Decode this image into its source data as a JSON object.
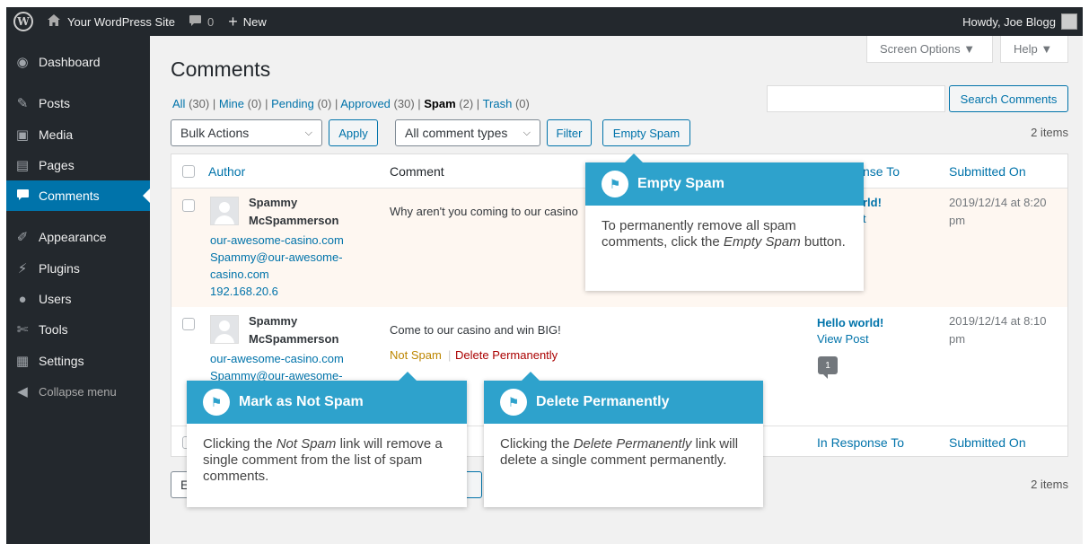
{
  "adminbar": {
    "wp_logo": "W",
    "site_name": "Your WordPress Site",
    "comments_count": "0",
    "new_label": "New",
    "howdy": "Howdy, Joe Blogg"
  },
  "sidebar": {
    "items": [
      {
        "label": "Dashboard",
        "icon": "dashboard-icon"
      },
      {
        "label": "Posts",
        "icon": "pin-icon"
      },
      {
        "label": "Media",
        "icon": "media-icon"
      },
      {
        "label": "Pages",
        "icon": "page-icon"
      },
      {
        "label": "Comments",
        "icon": "comment-icon"
      },
      {
        "label": "Appearance",
        "icon": "brush-icon"
      },
      {
        "label": "Plugins",
        "icon": "plug-icon"
      },
      {
        "label": "Users",
        "icon": "user-icon"
      },
      {
        "label": "Tools",
        "icon": "wrench-icon"
      },
      {
        "label": "Settings",
        "icon": "sliders-icon"
      },
      {
        "label": "Collapse menu",
        "icon": "collapse-icon"
      }
    ]
  },
  "top_buttons": {
    "screen_options": "Screen Options ▼",
    "help": "Help ▼"
  },
  "page": {
    "title": "Comments"
  },
  "filters": {
    "all": "All",
    "all_count": "(30)",
    "mine": "Mine",
    "mine_count": "(0)",
    "pending": "Pending",
    "pending_count": "(0)",
    "approved": "Approved",
    "approved_count": "(30)",
    "spam": "Spam",
    "spam_count": "(2)",
    "trash": "Trash",
    "trash_count": "(0)"
  },
  "search": {
    "button": "Search Comments",
    "placeholder": ""
  },
  "toolbar": {
    "bulk_actions": "Bulk Actions",
    "apply": "Apply",
    "comment_types": "All comment types",
    "filter": "Filter",
    "empty_spam": "Empty Spam",
    "items": "2 items"
  },
  "table": {
    "headers": {
      "author": "Author",
      "comment": "Comment",
      "in_response_to_partial": "nse To",
      "in_response_to": "In Response To",
      "submitted_on": "Submitted On"
    },
    "rows": [
      {
        "author": "Spammy\nMcSpammerson",
        "url": "our-awesome-casino.com",
        "email": "Spammy@our-awesome-\ncasino.com",
        "ip": "192.168.20.6",
        "comment": "Why aren't you coming to our casino",
        "response_partial": "rld!",
        "response_partial2": "t",
        "date": "2019/12/14 at 8:20\npm"
      },
      {
        "author": "Spammy\nMcSpammerson",
        "url": "our-awesome-casino.com",
        "email": "Spammy@our-awesome-",
        "comment": "Come to our casino and win BIG!",
        "not_spam": "Not Spam",
        "sep": "|",
        "delete": "Delete Permanently",
        "response": "Hello world!",
        "view_post": "View Post",
        "bubble_count": "1",
        "date": "2019/12/14 at 8:10\npm"
      }
    ]
  },
  "bottom": {
    "bulk_partial": "E",
    "apply_partial": "n",
    "items": "2 items"
  },
  "tooltips": {
    "empty_spam": {
      "title": "Empty Spam",
      "body_pre": "To permanently remove all spam comments, click the ",
      "body_em": "Empty Spam",
      "body_post": " button."
    },
    "not_spam": {
      "title": "Mark as Not Spam",
      "body_pre": "Clicking the ",
      "body_em": "Not Spam",
      "body_post": " link will remove a single comment from the list of spam comments."
    },
    "delete": {
      "title": "Delete Permanently",
      "body_pre": "Clicking the ",
      "body_em": "Delete Permanently",
      "body_post": " link will delete a single comment permanently."
    }
  },
  "colors": {
    "accent": "#0073aa",
    "tooltip_header": "#2ea2cc",
    "admin_bg": "#23282d",
    "spam_row_bg": "#fef7f1",
    "not_spam": "#bd8600",
    "delete": "#a00"
  }
}
